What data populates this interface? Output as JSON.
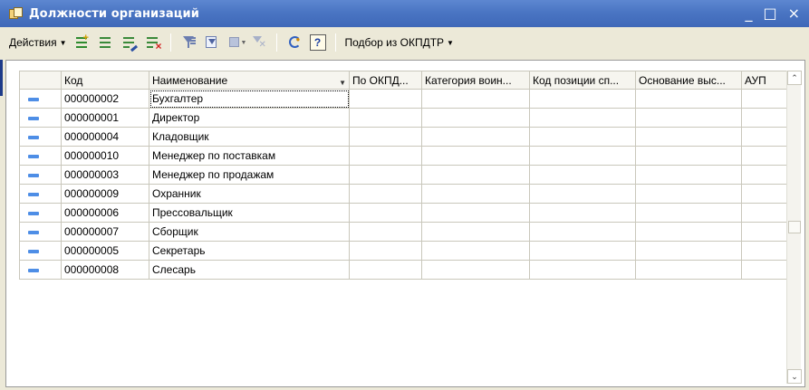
{
  "window": {
    "title": "Должности организаций",
    "minimize": "_",
    "maximize": "□",
    "close": "×"
  },
  "toolbar": {
    "actions_label": "Действия",
    "pick_label": "Подбор из ОКПДТР",
    "help_label": "?"
  },
  "table": {
    "columns": [
      "",
      "Код",
      "Наименование",
      "По ОКПД...",
      "Категория воин...",
      "Код позиции сп...",
      "Основание выс...",
      "АУП"
    ],
    "rows": [
      {
        "code": "000000002",
        "name": "Бухгалтер"
      },
      {
        "code": "000000001",
        "name": "Директор"
      },
      {
        "code": "000000004",
        "name": "Кладовщик"
      },
      {
        "code": "000000010",
        "name": "Менеджер по поставкам"
      },
      {
        "code": "000000003",
        "name": "Менеджер по продажам"
      },
      {
        "code": "000000009",
        "name": "Охранник"
      },
      {
        "code": "000000006",
        "name": "Прессовальщик"
      },
      {
        "code": "000000007",
        "name": "Сборщик"
      },
      {
        "code": "000000005",
        "name": "Секретарь"
      },
      {
        "code": "000000008",
        "name": "Слесарь"
      }
    ]
  },
  "colors": {
    "title_bar": "#4a75c3",
    "row_marker": "#4e8ee6",
    "background": "#ece9d8"
  }
}
